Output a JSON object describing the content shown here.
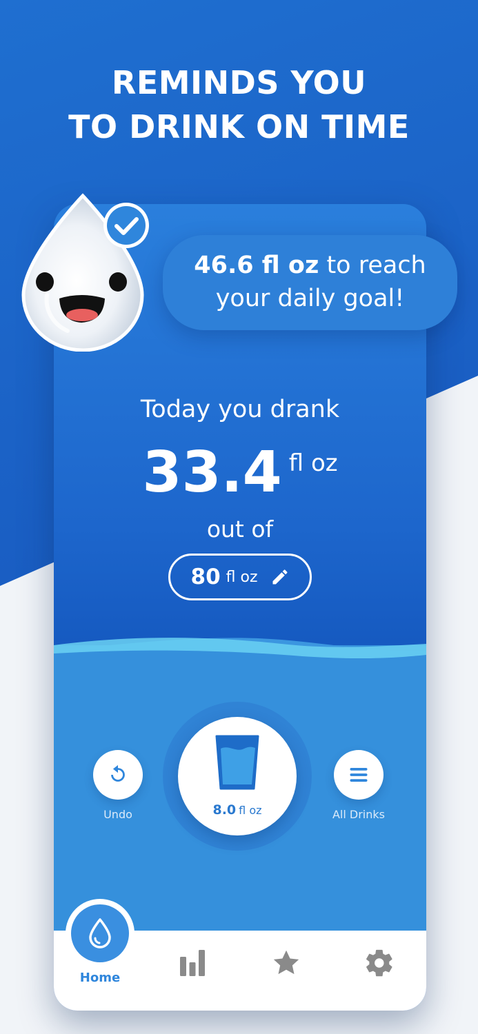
{
  "headline": {
    "line1": "REMINDS YOU",
    "line2": "TO DRINK ON TIME"
  },
  "bubble": {
    "amount": "46.6 fl oz",
    "text_after": " to reach",
    "line2": "your daily goal!"
  },
  "today": {
    "label": "Today you drank",
    "amount": "33.4",
    "unit": "fl oz",
    "out_of": "out of"
  },
  "goal": {
    "value": "80",
    "unit": "fl oz",
    "edit_icon": "pencil-icon"
  },
  "actions": {
    "undo_label": "Undo",
    "undo_icon": "undo-icon",
    "drink_amount": "8.0",
    "drink_unit": "fl oz",
    "drink_icon": "glass-icon",
    "all_drinks_label": "All Drinks",
    "all_drinks_icon": "list-icon"
  },
  "nav": {
    "home_label": "Home",
    "items": [
      {
        "icon": "drop-icon",
        "label": "Home",
        "active": true
      },
      {
        "icon": "bar-chart-icon",
        "active": false
      },
      {
        "icon": "star-icon",
        "active": false
      },
      {
        "icon": "gear-icon",
        "active": false
      }
    ]
  },
  "colors": {
    "brand_blue": "#1f6fd0",
    "accent_blue": "#3a8fe0",
    "nav_inactive": "#8a8a8a",
    "mascot_mouth": "#e8605f"
  }
}
